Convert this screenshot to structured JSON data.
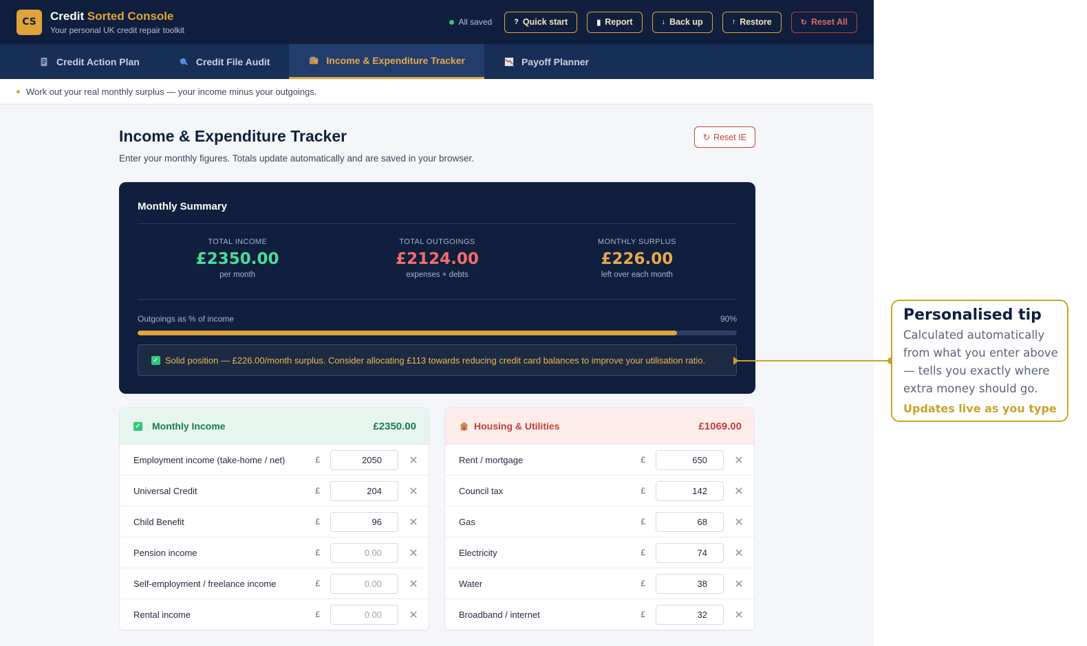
{
  "header": {
    "logo": "CS",
    "title_part1": "Credit",
    "title_part2": "Sorted Console",
    "subtitle": "Your personal UK credit repair toolkit",
    "saved_status": "All saved",
    "buttons": {
      "quick_start": "Quick start",
      "report": "Report",
      "backup": "Back up",
      "restore": "Restore",
      "reset_all": "Reset All"
    }
  },
  "tabs": [
    {
      "label": "Credit Action Plan",
      "icon": "document-icon"
    },
    {
      "label": "Credit File Audit",
      "icon": "search-icon"
    },
    {
      "label": "Income & Expenditure Tracker",
      "icon": "wallet-icon",
      "active": true
    },
    {
      "label": "Payoff Planner",
      "icon": "chart-icon"
    }
  ],
  "info_text": "Work out your real monthly surplus — your income minus your outgoings.",
  "page": {
    "title": "Income & Expenditure Tracker",
    "subtitle": "Enter your monthly figures. Totals update automatically and are saved in your browser.",
    "reset_label": "Reset IE"
  },
  "summary": {
    "title": "Monthly Summary",
    "income": {
      "label": "TOTAL INCOME",
      "value": "£2350.00",
      "sub": "per month",
      "color": "#4ade9a"
    },
    "outgoings": {
      "label": "TOTAL OUTGOINGS",
      "value": "£2124.00",
      "sub": "expenses + debts",
      "color": "#f26d6d"
    },
    "surplus": {
      "label": "MONTHLY SURPLUS",
      "value": "£226.00",
      "sub": "left over each month",
      "color": "#e9a94a"
    },
    "pct_label": "Outgoings as % of income",
    "pct_text": "90%",
    "pct_value": 0.9,
    "tip": "Solid position — £226.00/month surplus. Consider allocating £113 towards reducing credit card balances to improve your utilisation ratio."
  },
  "income_card": {
    "title": "Monthly Income",
    "total": "£2350.00",
    "currency": "£",
    "rows": [
      {
        "label": "Employment income (take-home / net)",
        "value": "2050"
      },
      {
        "label": "Universal Credit",
        "value": "204"
      },
      {
        "label": "Child Benefit",
        "value": "96"
      },
      {
        "label": "Pension income",
        "value": "",
        "placeholder": "0.00"
      },
      {
        "label": "Self-employment / freelance income",
        "value": "",
        "placeholder": "0.00"
      },
      {
        "label": "Rental income",
        "value": "",
        "placeholder": "0.00"
      }
    ]
  },
  "housing_card": {
    "title": "Housing & Utilities",
    "total": "£1069.00",
    "currency": "£",
    "rows": [
      {
        "label": "Rent / mortgage",
        "value": "650"
      },
      {
        "label": "Council tax",
        "value": "142"
      },
      {
        "label": "Gas",
        "value": "68"
      },
      {
        "label": "Electricity",
        "value": "74"
      },
      {
        "label": "Water",
        "value": "38"
      },
      {
        "label": "Broadband / internet",
        "value": "32"
      }
    ]
  },
  "callout": {
    "title": "Personalised tip",
    "body": "Calculated automatically from what you enter above — tells you exactly where extra money should go.",
    "footer": "Updates live as you type",
    "color": "#c9a22a"
  }
}
